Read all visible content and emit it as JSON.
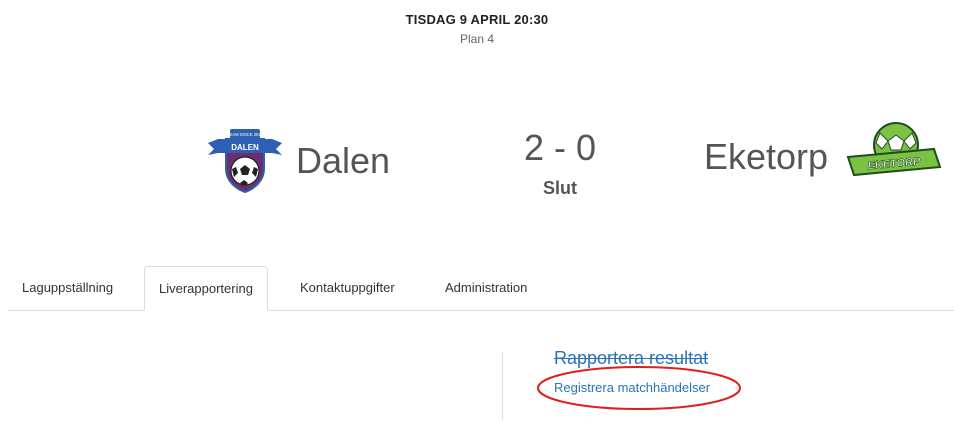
{
  "match": {
    "datetime": "TISDAG 9 APRIL 20:30",
    "plan": "Plan 4",
    "score": "2 - 0",
    "status": "Slut"
  },
  "home_team": {
    "name": "Dalen",
    "logo_icon": "dalen-club-crest-icon",
    "logo_banner_text": "DALEN",
    "logo_top_text": "TEAM SINCE 2018"
  },
  "away_team": {
    "name": "Eketorp",
    "logo_icon": "eketorp-club-crest-icon",
    "logo_banner_text": "EKETORP"
  },
  "tabs": [
    {
      "label": "Laguppställning",
      "active": false
    },
    {
      "label": "Liverapportering",
      "active": true
    },
    {
      "label": "Kontaktuppgifter",
      "active": false
    },
    {
      "label": "Administration",
      "active": false
    }
  ],
  "report": {
    "title": "Rapportera resultat",
    "link": "Registrera matchhändelser"
  },
  "colors": {
    "link": "#2a73b8",
    "annotation": "#e0201b",
    "home_banner": "#2f5fb3",
    "home_shield": "#6b2e6e",
    "away_green": "#7cc242"
  }
}
